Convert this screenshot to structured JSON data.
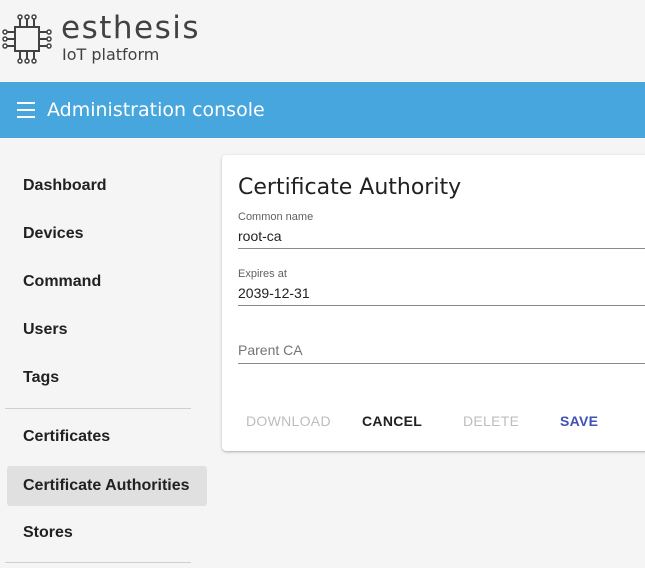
{
  "brand": {
    "name": "esthesis",
    "subtitle": "IoT platform"
  },
  "toolbar": {
    "title": "Administration console"
  },
  "sidebar": {
    "items": [
      {
        "label": "Dashboard",
        "active": false
      },
      {
        "label": "Devices",
        "active": false
      },
      {
        "label": "Command",
        "active": false
      },
      {
        "label": "Users",
        "active": false
      },
      {
        "label": "Tags",
        "active": false
      },
      {
        "label": "Certificates",
        "active": false
      },
      {
        "label": "Certificate Authorities",
        "active": true
      },
      {
        "label": "Stores",
        "active": false
      }
    ]
  },
  "card": {
    "title": "Certificate Authority",
    "fields": {
      "common_name": {
        "label": "Common name",
        "value": "root-ca"
      },
      "expires_at": {
        "label": "Expires at",
        "value": "2039-12-31"
      },
      "parent_ca": {
        "placeholder": "Parent CA"
      }
    },
    "buttons": {
      "download": "DOWNLOAD",
      "cancel": "CANCEL",
      "delete": "DELETE",
      "save": "SAVE"
    }
  },
  "colors": {
    "toolbar": "#47a6de",
    "primary_button": "#3f51b5",
    "active_nav": "#e0e0e0"
  },
  "icons": {
    "logo": "circuit-chip-icon",
    "menu": "hamburger-menu-icon"
  }
}
